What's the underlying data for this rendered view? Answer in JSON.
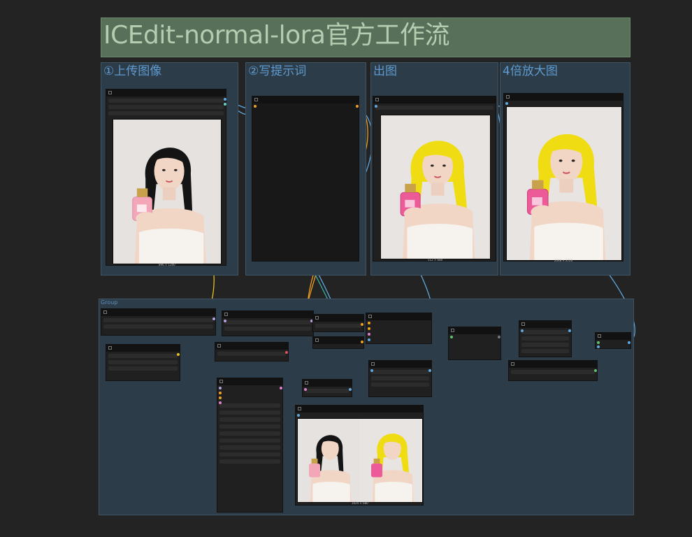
{
  "title": "ICEdit-normal-lora官方工作流",
  "groups": {
    "upload": "①上传图像",
    "prompt": "②写提示词",
    "output": "出图",
    "upscale": "4倍放大图",
    "bottom": "Group"
  },
  "previews": {
    "input_size": "896 × 1200",
    "output_size": "512 × 680",
    "upscaled_size": "2048 × 2720",
    "compare_size": "1024 × 680"
  },
  "icons": {
    "node_collapse": "square-icon",
    "portrait_original": "portrait-black-hair-image",
    "portrait_edited": "portrait-yellow-hair-image"
  },
  "colors": {
    "background": "#232323",
    "banner": "#58705a",
    "group": "#2c3c49",
    "wire_blue": "#5fa8e0",
    "wire_orange": "#f0a020",
    "wire_yellow": "#e8c020",
    "wire_pink": "#e080d0",
    "wire_green": "#60c070",
    "hair_black": "#141414",
    "hair_yellow": "#f0dc12"
  }
}
